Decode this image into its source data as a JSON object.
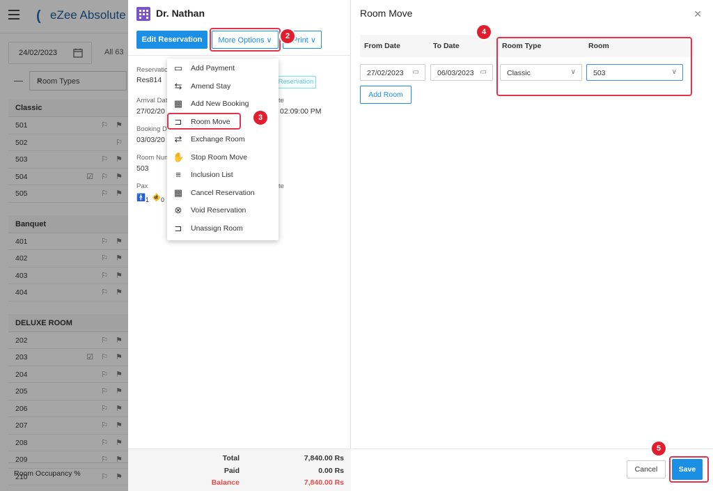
{
  "background": {
    "logo_text": "eZee Absolute",
    "date": "24/02/2023",
    "all_label": "All  63",
    "room_types_placeholder": "Room Types",
    "groups": [
      {
        "name": "Classic",
        "rooms": [
          "501",
          "502",
          "503",
          "504",
          "505"
        ]
      },
      {
        "name": "Banquet",
        "rooms": [
          "401",
          "402",
          "403",
          "404"
        ]
      },
      {
        "name": "DELUXE ROOM",
        "rooms": [
          "202",
          "203",
          "204",
          "205",
          "206",
          "207",
          "208",
          "209",
          "210"
        ]
      }
    ],
    "occupancy_label": "Room Occupancy %"
  },
  "reservation": {
    "guest_name": "Dr. Nathan",
    "edit_button": "Edit Reservation",
    "more_options_button": "More Options",
    "print_button": "Print",
    "fields": {
      "reservation_label": "Reservatio",
      "reservation_value": "Res814",
      "status_chip": "Reservation",
      "arrival_label": "Arrival Dat",
      "arrival_value": "27/02/20",
      "departure_label": "te",
      "departure_time": "02:09:00 PM",
      "booking_label": "Booking D",
      "booking_value": "03/03/20",
      "room_num_label": "Room Num",
      "room_num_value": "503",
      "pax_label": "Pax",
      "pax_adult": "1",
      "pax_child": "0",
      "rate_label": "te"
    },
    "totals": {
      "total_label": "Total",
      "total_value": "7,840.00 Rs",
      "paid_label": "Paid",
      "paid_value": "0.00 Rs",
      "balance_label": "Balance",
      "balance_value": "7,840.00 Rs"
    }
  },
  "menu": {
    "items": [
      {
        "label": "Add Payment",
        "icon": "payment-icon"
      },
      {
        "label": "Amend Stay",
        "icon": "amend-icon"
      },
      {
        "label": "Add New Booking",
        "icon": "calendar-icon"
      },
      {
        "label": "Room Move",
        "icon": "bed-move-icon"
      },
      {
        "label": "Exchange Room",
        "icon": "exchange-icon"
      },
      {
        "label": "Stop Room Move",
        "icon": "hand-icon"
      },
      {
        "label": "Inclusion List",
        "icon": "list-icon"
      },
      {
        "label": "Cancel Reservation",
        "icon": "calendar-cancel-icon"
      },
      {
        "label": "Void Reservation",
        "icon": "void-icon"
      },
      {
        "label": "Unassign Room",
        "icon": "unassign-icon"
      }
    ]
  },
  "room_move": {
    "title": "Room Move",
    "headers": {
      "from_date": "From Date",
      "to_date": "To Date",
      "room_type": "Room Type",
      "room": "Room"
    },
    "from_date": "27/02/2023",
    "to_date": "06/03/2023",
    "room_type": "Classic",
    "room": "503",
    "add_room_button": "Add Room",
    "cancel_button": "Cancel",
    "save_button": "Save"
  },
  "badges": [
    "2",
    "3",
    "4",
    "5"
  ],
  "colors": {
    "accent": "#1a8fe3",
    "highlight": "#e0344e",
    "badge": "#e01e2e",
    "balance": "#e94b4b"
  }
}
